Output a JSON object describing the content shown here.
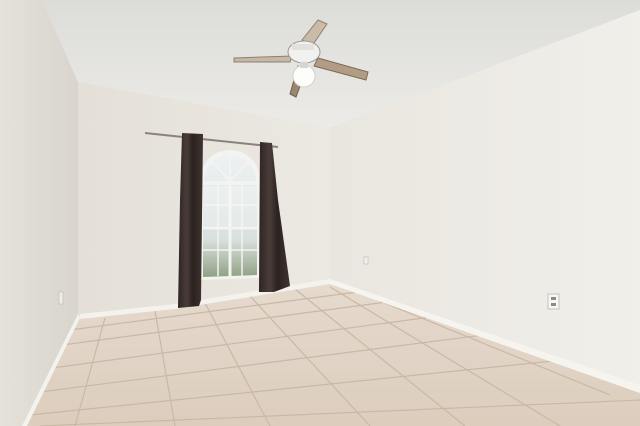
{
  "scene": {
    "kind": "photo",
    "subject": "empty-room"
  },
  "colors": {
    "ceiling": "#e6e6e2",
    "wall_left": "#e3e0d9",
    "wall_back": "#ebe8e1",
    "wall_right": "#eeece6",
    "floor_tile": "#e0d2c3",
    "grout": "#cbbba9",
    "baseboard": "#f4f2ed",
    "curtain": "#3a2f2c",
    "window_frame": "#f2f2f0",
    "fan_blade": "#b8a48e"
  }
}
